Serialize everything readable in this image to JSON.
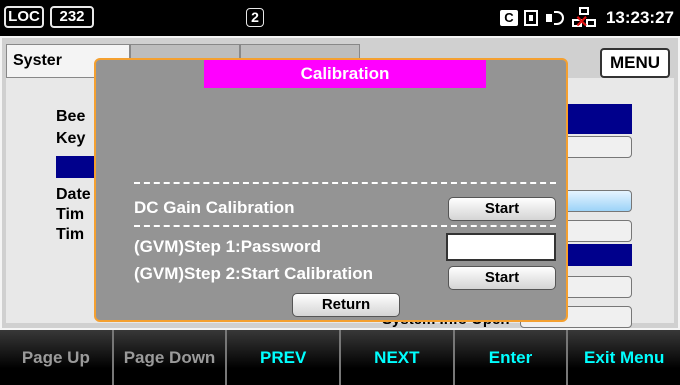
{
  "status_bar": {
    "loc_label": "LOC",
    "address": "232",
    "page_indicator": "2",
    "ce_icon_label": "C",
    "time": "13:23:27",
    "icons": [
      "ce-icon",
      "keyboard-icon",
      "speaker-icon",
      "lan-disconnected-icon"
    ]
  },
  "tabs": [
    {
      "label": "Syster"
    }
  ],
  "menu_button": "MENU",
  "background_labels": [
    "Bee",
    "Key",
    "Date",
    "Tim",
    "Tim"
  ],
  "background_bottom_text": "System Info   Open",
  "dialog": {
    "title": "Calibration",
    "dc_gain_label": "DC Gain Calibration",
    "dc_gain_button": "Start",
    "step1_label": "(GVM)Step 1:Password",
    "password_value": "",
    "step2_label": "(GVM)Step 2:Start Calibration",
    "step2_button": "Start",
    "return_button": "Return"
  },
  "softkeys": [
    {
      "label": "Page Up",
      "state": "disabled"
    },
    {
      "label": "Page Down",
      "state": "disabled"
    },
    {
      "label": "PREV",
      "state": "active"
    },
    {
      "label": "NEXT",
      "state": "active"
    },
    {
      "label": "Enter",
      "state": "active"
    },
    {
      "label": "Exit Menu",
      "state": "active"
    }
  ],
  "colors": {
    "title_bar": "#ff00ff",
    "dialog_border": "#f4a030",
    "softkey_active": "#00ffff",
    "softkey_disabled": "#9a9a9a",
    "selection_bar": "#00008c"
  }
}
